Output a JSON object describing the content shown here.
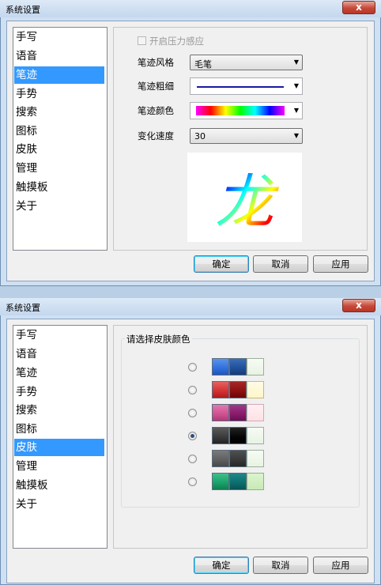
{
  "window_title": "系统设置",
  "close_glyph": "x",
  "sidebar_items": [
    "手写",
    "语音",
    "笔迹",
    "手势",
    "搜索",
    "图标",
    "皮肤",
    "管理",
    "触摸板",
    "关于"
  ],
  "top": {
    "selected_index": 2,
    "pressure_checkbox": {
      "label": "开启压力感应",
      "checked": false,
      "enabled": false
    },
    "stroke_style": {
      "label": "笔迹风格",
      "value": "毛笔"
    },
    "stroke_width": {
      "label": "笔迹粗细",
      "color": "#1a1aa0"
    },
    "stroke_color": {
      "label": "笔迹颜色"
    },
    "speed": {
      "label": "变化速度",
      "value": "30"
    },
    "preview_glyph": "龙"
  },
  "bottom": {
    "selected_index": 6,
    "group_title": "请选择皮肤颜色",
    "skins": [
      {
        "colors": [
          "#2f6fdc",
          "#1f4f99",
          "#e8f3e3"
        ],
        "selected": false
      },
      {
        "colors": [
          "#d43030",
          "#8c1010",
          "#fff6c8"
        ],
        "selected": false
      },
      {
        "colors": [
          "#d05090",
          "#881a6a",
          "#fde1e6"
        ],
        "selected": false
      },
      {
        "colors": [
          "#3a3a3a",
          "#050505",
          "#e8f3e3"
        ],
        "selected": true
      },
      {
        "colors": [
          "#5e5e5e",
          "#383838",
          "#e8f3e3"
        ],
        "selected": false
      },
      {
        "colors": [
          "#1aa06a",
          "#0c6e6e",
          "#c8eab6"
        ],
        "selected": false
      }
    ]
  },
  "buttons": {
    "ok": "确定",
    "cancel": "取消",
    "apply": "应用"
  }
}
